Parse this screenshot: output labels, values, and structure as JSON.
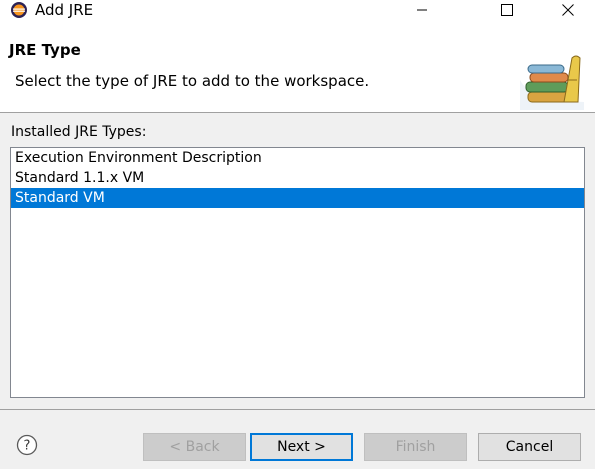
{
  "window": {
    "title": "Add JRE",
    "controls": {
      "minimize": "minimize",
      "maximize": "maximize",
      "close": "close"
    }
  },
  "header": {
    "title": "JRE Type",
    "description": "Select the type of JRE to add to the workspace.",
    "icon": "books-stack-icon"
  },
  "jre_types": {
    "label": "Installed JRE Types:",
    "items": [
      {
        "label": "Execution Environment Description",
        "selected": false
      },
      {
        "label": "Standard 1.1.x VM",
        "selected": false
      },
      {
        "label": "Standard VM",
        "selected": true
      }
    ]
  },
  "footer": {
    "help_icon": "help-icon",
    "back_label": "< Back",
    "next_label": "Next >",
    "finish_label": "Finish",
    "cancel_label": "Cancel"
  },
  "colors": {
    "selection": "#0078d7",
    "header_bg": "#ffffff",
    "dialog_bg": "#f0f0f0"
  }
}
